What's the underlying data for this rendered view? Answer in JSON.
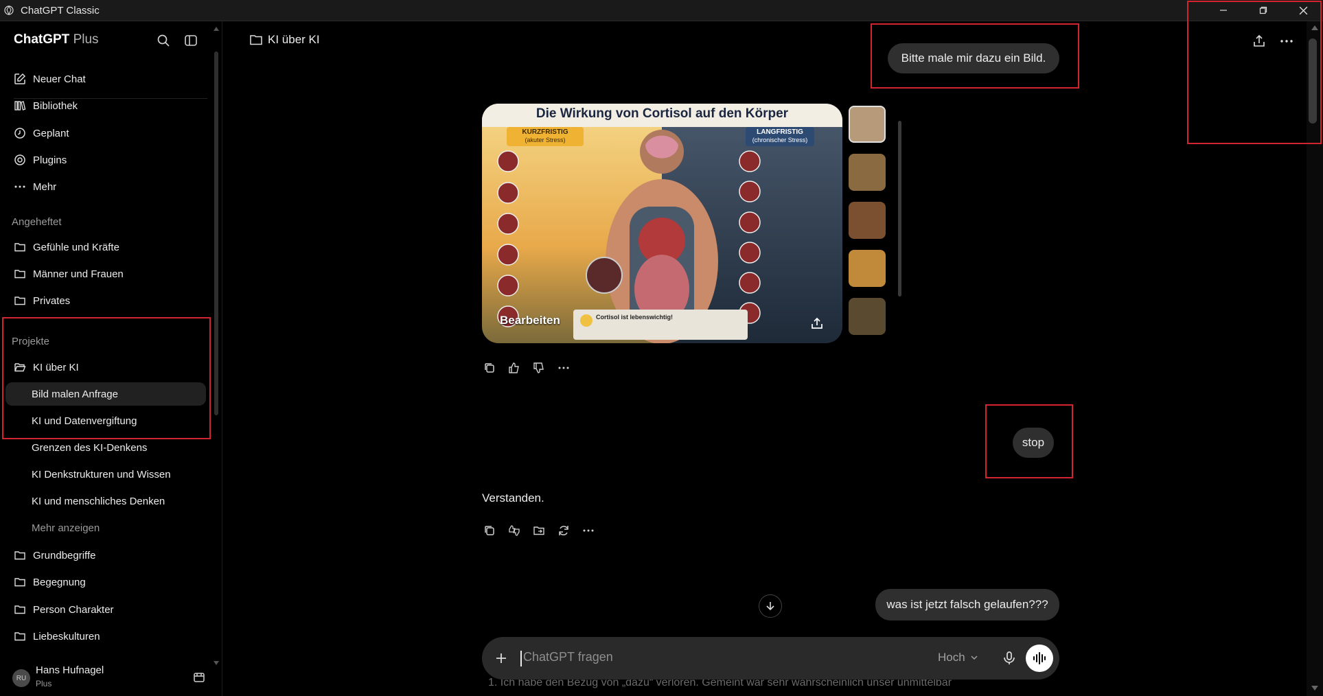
{
  "window": {
    "title": "ChatGPT Classic"
  },
  "sidebar": {
    "brand": "ChatGPT",
    "brand_plan": "Plus",
    "nav": [
      {
        "label": "Neuer Chat",
        "icon": "compose-icon"
      },
      {
        "label": "Bibliothek",
        "icon": "library-icon"
      },
      {
        "label": "Geplant",
        "icon": "clock-icon"
      },
      {
        "label": "Plugins",
        "icon": "plugins-icon"
      },
      {
        "label": "Mehr",
        "icon": "more-dots-icon"
      }
    ],
    "pinned_title": "Angeheftet",
    "pinned": [
      "Gefühle und Kräfte",
      "Männer und Frauen",
      "Privates"
    ],
    "projects_title": "Projekte",
    "project": "KI über KI",
    "project_chats": [
      "Bild malen Anfrage",
      "KI und Datenvergiftung",
      "Grenzen des KI-Denkens",
      "KI Denkstrukturen und Wissen",
      "KI und menschliches Denken"
    ],
    "show_more": "Mehr anzeigen",
    "folders": [
      "Grundbegriffe",
      "Begegnung",
      "Person Charakter",
      "Liebeskulturen"
    ],
    "user": {
      "initials": "RU",
      "name": "Hans Hufnagel",
      "plan": "Plus"
    }
  },
  "main": {
    "title": "KI über KI",
    "messages": {
      "user1": "Bitte male mir dazu ein Bild.",
      "image_title": "Die Wirkung von Cortisol auf den Körper",
      "image_left_header": "KURZFRISTIG",
      "image_left_sub": "(akuter Stress)",
      "image_right_header": "LANGFRISTIG",
      "image_right_sub": "(chronischer Stress)",
      "image_note_title": "Cortisol ist lebenswichtig!",
      "image_edit": "Bearbeiten",
      "user2": "stop",
      "assistant2": "Verstanden.",
      "user3": "was ist jetzt falsch gelaufen???"
    },
    "composer": {
      "placeholder": "ChatGPT fragen",
      "mode": "Hoch"
    },
    "bottom_text": "1.  Ich habe den Bezug von „dazu“ verloren. Gemeint war sehr wahrscheinlich unser unmittelbar"
  },
  "colors": {
    "background": "#000000",
    "surface": "#2f2f2f",
    "highlight": "#d1242f"
  }
}
